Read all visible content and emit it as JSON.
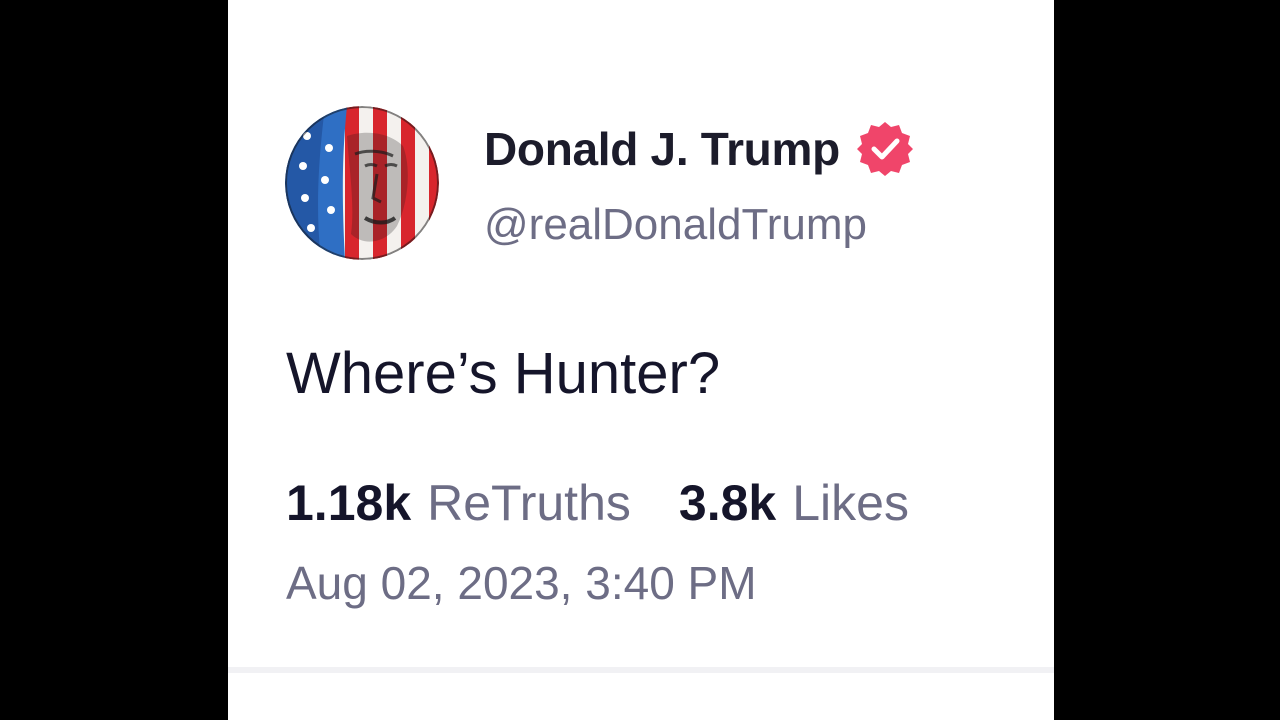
{
  "post": {
    "author": {
      "display_name": "Donald J. Trump",
      "handle": "@realDonaldTrump",
      "verified": true,
      "verified_icon": "verified-badge-icon",
      "avatar_icon": "flag-portrait-avatar"
    },
    "text": "Where’s Hunter?",
    "stats": {
      "retruths_count": "1.18k",
      "retruths_label": "ReTruths",
      "likes_count": "3.8k",
      "likes_label": "Likes"
    },
    "timestamp": "Aug 02, 2023, 3:40 PM"
  },
  "colors": {
    "verified_badge": "#f0456a",
    "name_text": "#1c1c2b",
    "muted_text": "#6d6d85",
    "background": "#ffffff",
    "letterbox": "#000000"
  }
}
